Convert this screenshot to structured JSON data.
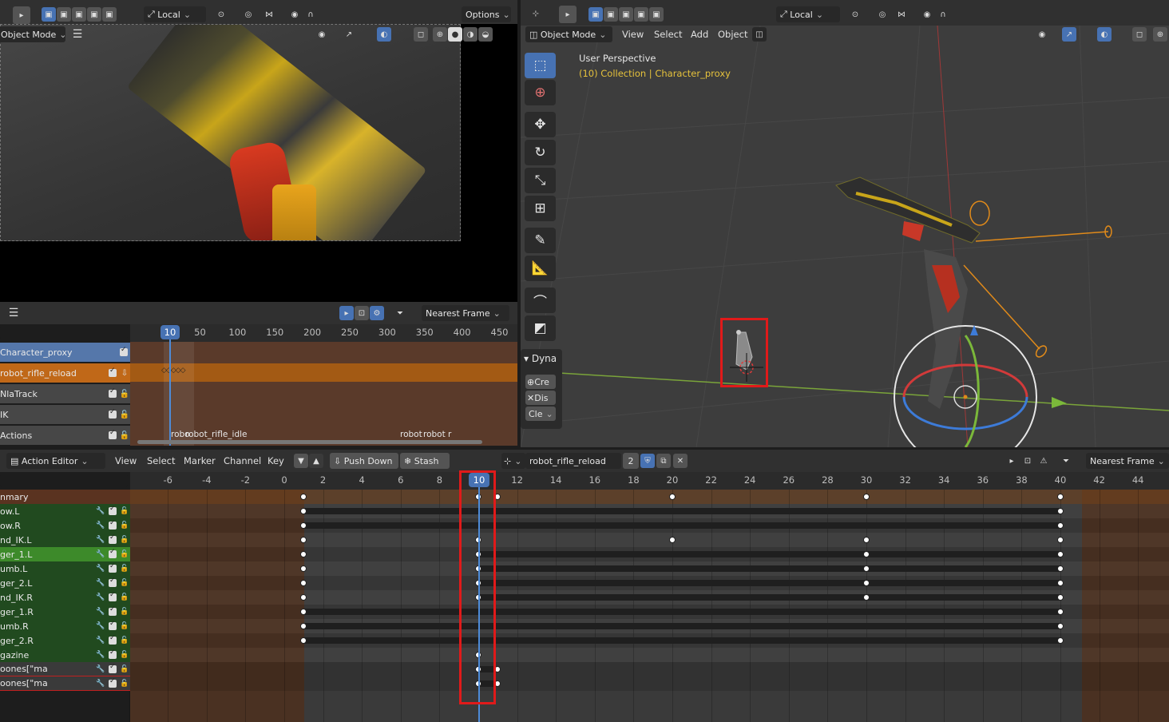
{
  "top_left": {
    "header": {
      "pivot": "Local",
      "options": "Options"
    },
    "mode": "Object Mode"
  },
  "nla": {
    "snap": "Nearest Frame",
    "current_frame": "10",
    "ticks": [
      "50",
      "100",
      "150",
      "200",
      "250",
      "300",
      "350",
      "400",
      "450"
    ],
    "channels": [
      {
        "name": "Character_proxy",
        "style": "object"
      },
      {
        "name": "robot_rifle_reload",
        "style": "action"
      },
      {
        "name": "NlaTrack",
        "style": "track"
      },
      {
        "name": "IK",
        "style": "track"
      },
      {
        "name": "Actions",
        "style": "track"
      }
    ],
    "strip_labels": [
      "robo",
      "robot_rifle_idle",
      "robot",
      "robot r"
    ]
  },
  "viewport": {
    "header": {
      "pivot": "Local"
    },
    "mode": "Object Mode",
    "menus": [
      "View",
      "Select",
      "Add",
      "Object"
    ],
    "overlay_title": "User Perspective",
    "overlay_collection": "(10) Collection | Character_proxy",
    "redo_panel": {
      "title": "Dyna",
      "buttons": [
        "Cre",
        "Dis",
        "Cle"
      ]
    }
  },
  "action_editor": {
    "mode": "Action Editor",
    "menus": [
      "View",
      "Select",
      "Marker",
      "Channel",
      "Key"
    ],
    "push_down": "Push Down",
    "stash": "Stash",
    "action_name": "robot_rifle_reload",
    "users": "2",
    "snap": "Nearest Frame",
    "current_frame": "10",
    "ticks": [
      "-6",
      "-4",
      "-2",
      "0",
      "2",
      "4",
      "6",
      "8",
      "12",
      "14",
      "16",
      "18",
      "20",
      "22",
      "24",
      "26",
      "28",
      "30",
      "32",
      "34",
      "36",
      "38",
      "40",
      "42",
      "44"
    ],
    "channels": [
      {
        "name": "nmary",
        "style": "summary"
      },
      {
        "name": "ow.L",
        "style": "bone"
      },
      {
        "name": "ow.R",
        "style": "bone"
      },
      {
        "name": "nd_IK.L",
        "style": "bone"
      },
      {
        "name": "ger_1.L",
        "style": "selected"
      },
      {
        "name": "umb.L",
        "style": "bone"
      },
      {
        "name": "ger_2.L",
        "style": "bone"
      },
      {
        "name": "nd_IK.R",
        "style": "bone"
      },
      {
        "name": "ger_1.R",
        "style": "bone"
      },
      {
        "name": "umb.R",
        "style": "bone"
      },
      {
        "name": "ger_2.R",
        "style": "bone"
      },
      {
        "name": "gazine",
        "style": "bone"
      },
      {
        "name": "oones[\"ma",
        "style": "prop"
      },
      {
        "name": "oones[\"ma",
        "style": "prop"
      }
    ],
    "keyframes": [
      [
        1,
        10,
        11,
        20,
        30,
        40
      ],
      [
        1,
        40
      ],
      [
        1,
        40
      ],
      [
        1,
        10,
        20,
        30,
        40
      ],
      [
        1,
        10,
        30,
        40
      ],
      [
        1,
        10,
        30,
        40
      ],
      [
        1,
        10,
        30,
        40
      ],
      [
        1,
        10,
        30,
        40
      ],
      [
        1,
        40
      ],
      [
        1,
        40
      ],
      [
        1,
        40
      ],
      [
        10
      ],
      [
        10,
        11
      ],
      [
        10,
        11
      ]
    ],
    "holds": [
      [],
      [
        [
          1,
          40
        ]
      ],
      [
        [
          1,
          40
        ]
      ],
      [],
      [
        [
          10,
          30
        ],
        [
          30,
          40
        ]
      ],
      [
        [
          10,
          30
        ],
        [
          30,
          40
        ]
      ],
      [
        [
          10,
          30
        ],
        [
          30,
          40
        ]
      ],
      [
        [
          10,
          30
        ],
        [
          30,
          40
        ]
      ],
      [
        [
          1,
          40
        ]
      ],
      [
        [
          1,
          40
        ]
      ],
      [
        [
          1,
          40
        ]
      ],
      [],
      [
        [
          10,
          11
        ]
      ],
      [
        [
          10,
          11
        ]
      ]
    ]
  },
  "colors": {
    "accent": "#4772b3",
    "orange": "#d07418",
    "highlight": "#e01a1a",
    "bone_green": "#1f4a1f"
  }
}
